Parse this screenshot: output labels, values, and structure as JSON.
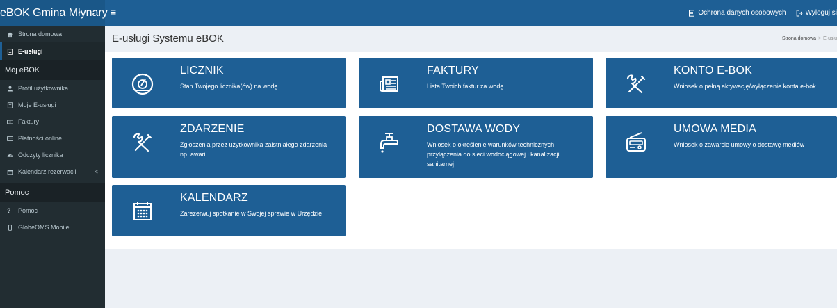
{
  "app": {
    "brand": "eBOK Gmina Młynary",
    "menu_icon": "≡"
  },
  "topbar": {
    "privacy_label": "Ochrona danych osobowych",
    "logout_label": "Wyloguj si"
  },
  "sidebar": {
    "items_top": [
      {
        "label": "Strona domowa",
        "icon": "home-icon"
      },
      {
        "label": "E-usługi",
        "icon": "file-icon",
        "active": true
      }
    ],
    "section_my": "Mój eBOK",
    "items_my": [
      {
        "label": "Profil użytkownika",
        "icon": "user-icon"
      },
      {
        "label": "Moje E-usługi",
        "icon": "file-icon"
      },
      {
        "label": "Faktury",
        "icon": "money-icon"
      },
      {
        "label": "Płatności online",
        "icon": "card-icon"
      },
      {
        "label": "Odczyty licznika",
        "icon": "tachometer-icon"
      },
      {
        "label": "Kalendarz rezerwacji",
        "icon": "calendar-icon",
        "chevron": "<"
      }
    ],
    "section_help": "Pomoc",
    "items_help": [
      {
        "label": "Pomoc",
        "icon": "question-icon",
        "glyph": "?"
      },
      {
        "label": "GlobeOMS Mobile",
        "icon": "mobile-icon"
      }
    ]
  },
  "header": {
    "title": "E-usługi Systemu eBOK",
    "breadcrumb_home": "Strona domowa",
    "breadcrumb_sep": ">",
    "breadcrumb_current": "E-usłu"
  },
  "tiles": [
    {
      "title": "LICZNIK",
      "desc": "Stan Twojego licznika(ów) na wodę",
      "icon": "gauge-icon"
    },
    {
      "title": "FAKTURY",
      "desc": "Lista Twoich faktur za wodę",
      "icon": "newspaper-icon"
    },
    {
      "title": "KONTO E-BOK",
      "desc": "Wniosek o pełną aktywację/wyłączenie konta e-bok",
      "icon": "tools-icon"
    },
    {
      "title": "ZDARZENIE",
      "desc": "Zgłoszenia przez użytkownika zaistniałego zdarzenia np. awarii",
      "icon": "tools-icon"
    },
    {
      "title": "DOSTAWA WODY",
      "desc": "Wniosek o określenie warunków technicznych przyłączenia do sieci wodociągowej i kanalizacji sanitarnej",
      "icon": "faucet-icon"
    },
    {
      "title": "UMOWA MEDIA",
      "desc": "Wniosek o zawarcie umowy o dostawę mediów",
      "icon": "radio-icon"
    },
    {
      "title": "KALENDARZ",
      "desc": "Zarezerwuj spotkanie w Swojej sprawie w Urzędzie",
      "icon": "calendar-icon"
    }
  ],
  "colors": {
    "primary": "#1e5f95",
    "sidebar": "#222d32",
    "background": "#ecf0f5"
  }
}
